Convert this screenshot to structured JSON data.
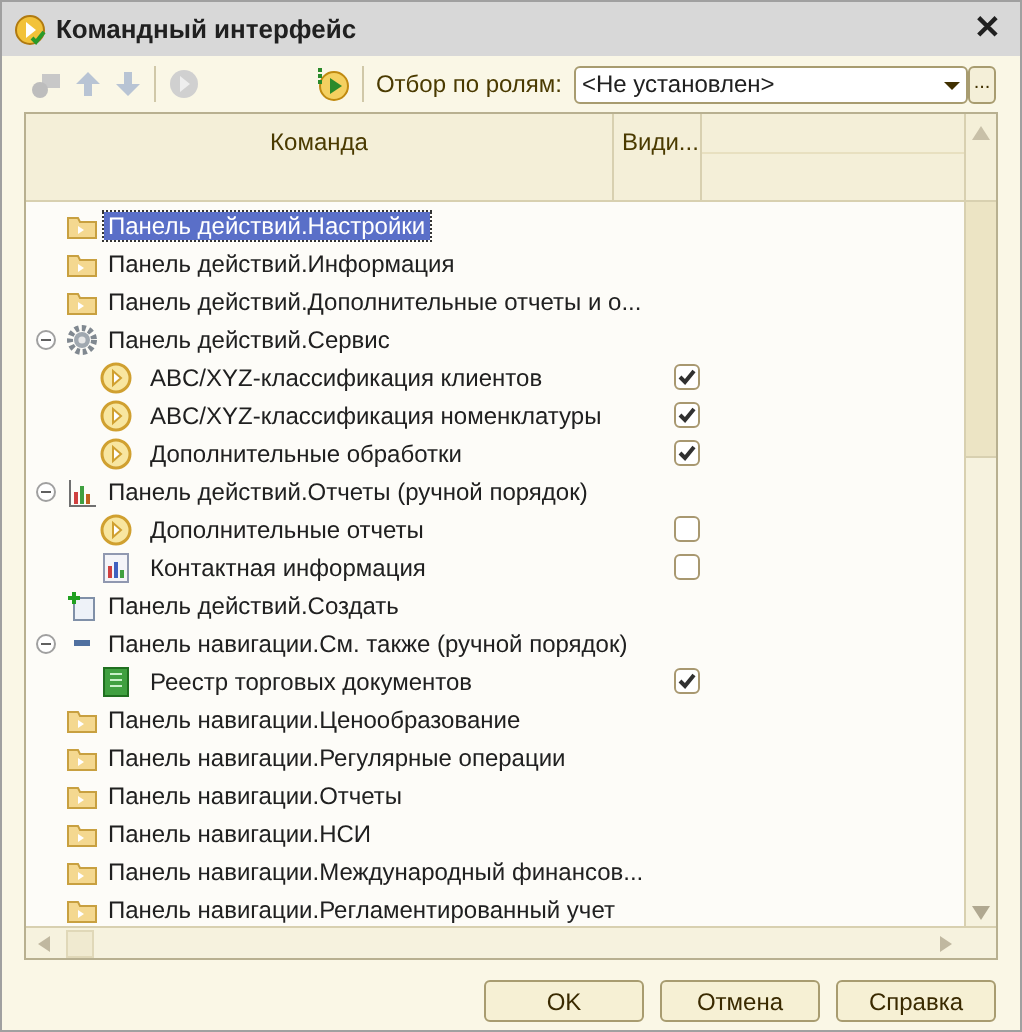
{
  "window": {
    "title": "Командный интерфейс",
    "close": "✕"
  },
  "toolbar": {
    "filter_label": "Отбор по ролям:",
    "filter_value": "<Не установлен>",
    "more_button": "..."
  },
  "table": {
    "columns": [
      "Команда",
      "Види..."
    ],
    "rows": [
      {
        "label": "Панель действий.Настройки",
        "kind": "folder",
        "selected": true
      },
      {
        "label": "Панель действий.Информация",
        "kind": "folder",
        "selected": false
      },
      {
        "label": "Панель действий.Дополнительные отчеты и о...",
        "kind": "folder",
        "selected": false
      },
      {
        "label": "Панель действий.Сервис",
        "kind": "gear",
        "selected": false,
        "expanded": true,
        "children": [
          {
            "label": "ABC/XYZ-классификация клиентов",
            "kind": "play",
            "selected": false,
            "visible": true
          },
          {
            "label": "ABC/XYZ-классификация номенклатуры",
            "kind": "play",
            "selected": false,
            "visible": true
          },
          {
            "label": "Дополнительные обработки",
            "kind": "play",
            "selected": false,
            "visible": true
          }
        ]
      },
      {
        "label": "Панель действий.Отчеты (ручной порядок)",
        "kind": "chart",
        "selected": false,
        "expanded": true,
        "children": [
          {
            "label": "Дополнительные отчеты",
            "kind": "play",
            "selected": false,
            "visible": false
          },
          {
            "label": "Контактная информация",
            "kind": "report",
            "selected": false,
            "visible": false
          }
        ]
      },
      {
        "label": "Панель действий.Создать",
        "kind": "add",
        "selected": false
      },
      {
        "label": "Панель навигации.См. также (ручной порядок)",
        "kind": "dash",
        "selected": false,
        "expanded": true,
        "children": [
          {
            "label": "Реестр торговых документов",
            "kind": "register",
            "selected": false,
            "visible": true
          }
        ]
      },
      {
        "label": "Панель навигации.Ценообразование",
        "kind": "folder",
        "selected": false
      },
      {
        "label": "Панель навигации.Регулярные операции",
        "kind": "folder",
        "selected": false
      },
      {
        "label": "Панель навигации.Отчеты",
        "kind": "folder",
        "selected": false
      },
      {
        "label": "Панель навигации.НСИ",
        "kind": "folder",
        "selected": false
      },
      {
        "label": "Панель навигации.Международный финансов...",
        "kind": "folder",
        "selected": false
      },
      {
        "label": "Панель навигации.Регламентированный учет",
        "kind": "folder",
        "selected": false
      }
    ]
  },
  "buttons": [
    "OK",
    "Отмена",
    "Справка"
  ]
}
